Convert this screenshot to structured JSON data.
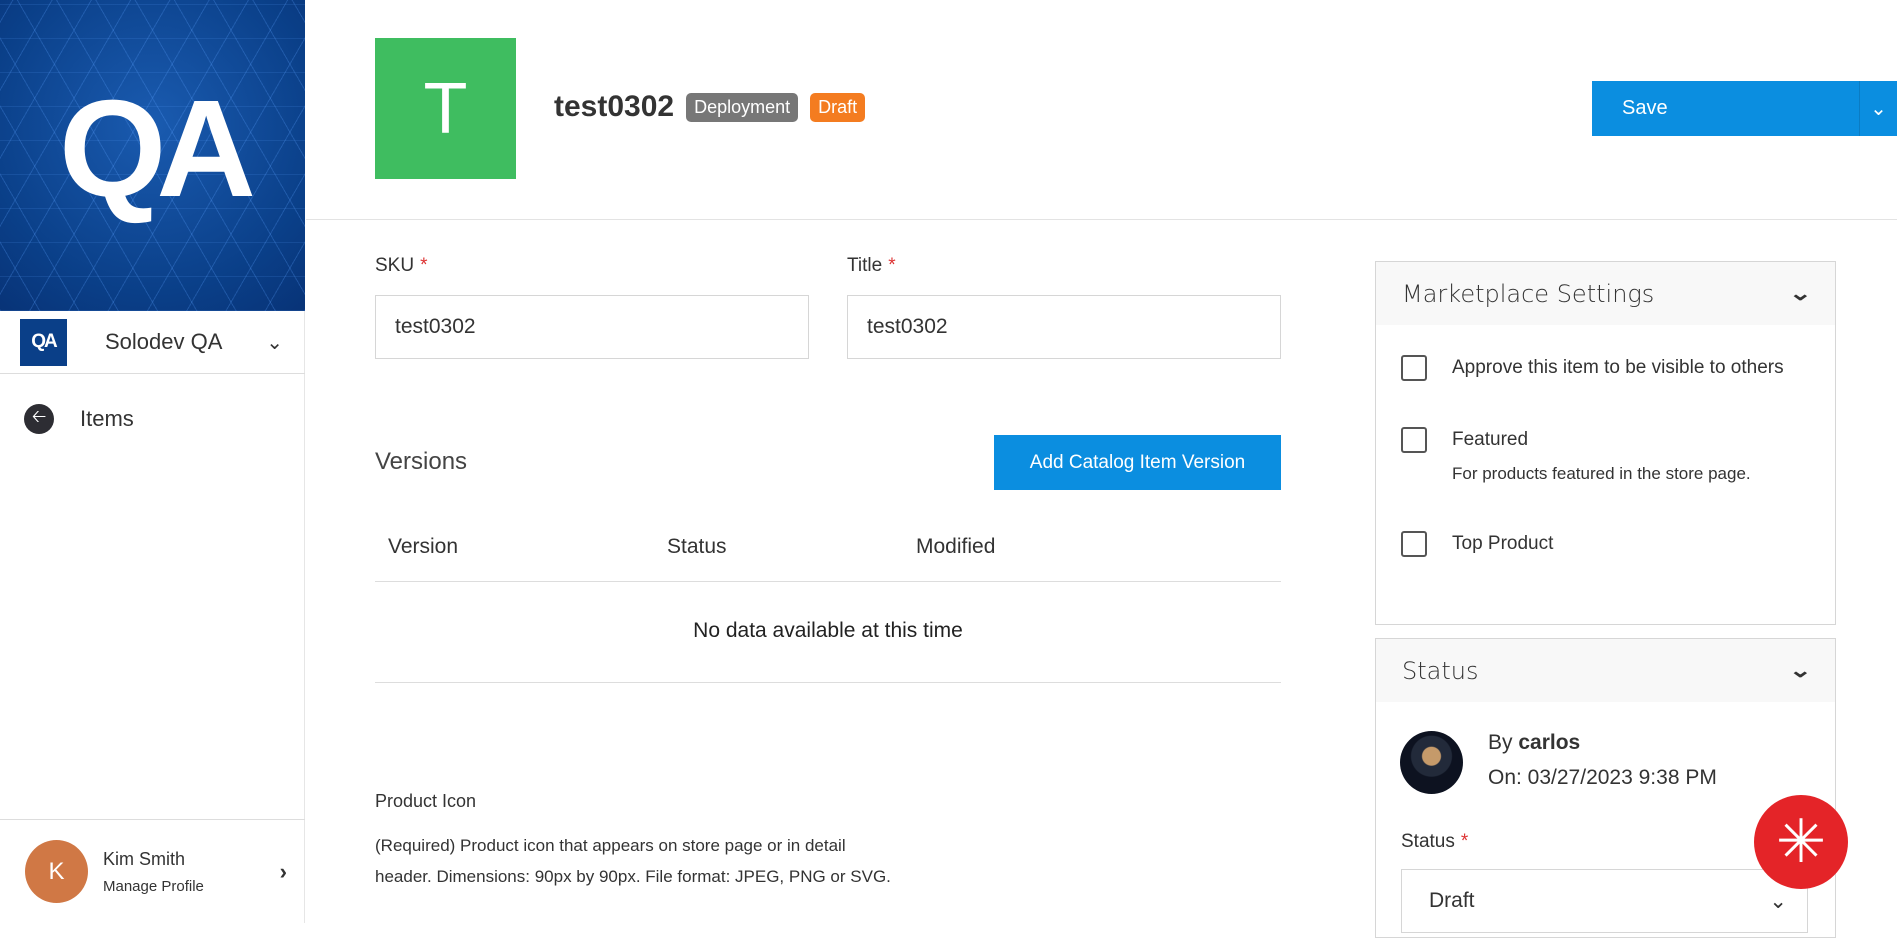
{
  "sidebar": {
    "banner_logo": "QA",
    "org_logo": "QA",
    "org_name": "Solodev QA",
    "back_label": "Items",
    "profile": {
      "initial": "K",
      "name": "Kim Smith",
      "link": "Manage Profile"
    }
  },
  "header": {
    "tile_letter": "T",
    "title": "test0302",
    "badges": [
      {
        "label": "Deployment",
        "color": "#777777"
      },
      {
        "label": "Draft",
        "color": "#f47c20"
      }
    ],
    "save_label": "Save"
  },
  "form": {
    "sku_label": "SKU",
    "sku_value": "test0302",
    "title_label": "Title",
    "title_value": "test0302",
    "required_mark": "*"
  },
  "versions": {
    "heading": "Versions",
    "add_label": "Add Catalog Item Version",
    "columns": [
      "Version",
      "Status",
      "Modified"
    ],
    "empty": "No data available at this time"
  },
  "product_icon": {
    "label": "Product Icon",
    "description": "(Required) Product icon that appears on store page or in detail header. Dimensions: 90px by 90px. File format: JPEG, PNG or SVG."
  },
  "marketplace": {
    "title": "Marketplace Settings",
    "options": [
      {
        "label": "Approve this item to be visible to others",
        "checked": false
      },
      {
        "label": "Featured",
        "sub": "For products featured in the store page.",
        "checked": false
      },
      {
        "label": "Top Product",
        "checked": false
      }
    ]
  },
  "status": {
    "title": "Status",
    "by_prefix": "By",
    "by_user": "carlos",
    "on": "On: 03/27/2023 9:38 PM",
    "field_label": "Status",
    "value": "Draft"
  }
}
